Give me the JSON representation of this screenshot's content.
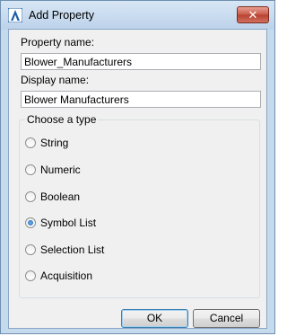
{
  "window": {
    "title": "Add Property",
    "close_label": "✕"
  },
  "form": {
    "property_name_label": "Property name:",
    "property_name_value": "Blower_Manufacturers",
    "display_name_label": "Display name:",
    "display_name_value": "Blower Manufacturers"
  },
  "type_group": {
    "legend": "Choose a type",
    "options": [
      {
        "label": "String",
        "checked": false
      },
      {
        "label": "Numeric",
        "checked": false
      },
      {
        "label": "Boolean",
        "checked": false
      },
      {
        "label": "Symbol List",
        "checked": true
      },
      {
        "label": "Selection List",
        "checked": false
      },
      {
        "label": "Acquisition",
        "checked": false
      }
    ]
  },
  "buttons": {
    "ok": "OK",
    "cancel": "Cancel"
  },
  "colors": {
    "app_icon": "#1e5fa8"
  }
}
